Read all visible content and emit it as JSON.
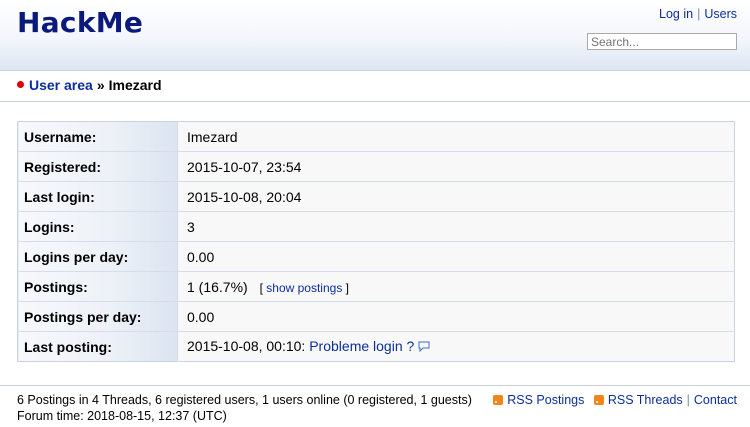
{
  "header": {
    "logo": "HackMe",
    "login_label": "Log in",
    "separator": "|",
    "users_label": "Users",
    "search_placeholder": "Search..."
  },
  "breadcrumb": {
    "parent": "User area",
    "arrow": "»",
    "current": "Imezard"
  },
  "profile": {
    "rows": [
      {
        "label": "Username:",
        "value": "Imezard"
      },
      {
        "label": "Registered:",
        "value": "2015-10-07, 23:54"
      },
      {
        "label": "Last login:",
        "value": "2015-10-08, 20:04"
      },
      {
        "label": "Logins:",
        "value": "3"
      },
      {
        "label": "Logins per day:",
        "value": "0.00"
      },
      {
        "label": "Postings:",
        "value": "1 (16.7%)"
      },
      {
        "label": "Postings per day:",
        "value": "0.00"
      },
      {
        "label": "Last posting:",
        "value": "2015-10-08, 00:10:"
      }
    ],
    "show_postings_open": "[",
    "show_postings_label": "show postings",
    "show_postings_close": "]",
    "last_posting_title": "Probleme login ?"
  },
  "footer": {
    "stats": "6 Postings in 4 Threads, 6 registered users, 1 users online (0 registered, 1 guests)",
    "forum_time": "Forum time: 2018-08-15, 12:37 (UTC)",
    "rss_postings": "RSS Postings",
    "rss_threads": "RSS Threads",
    "contact": "Contact",
    "separator": "|"
  },
  "icons": {
    "bullet": "red-dot-icon",
    "rss": "rss-icon",
    "comment": "speech-bubble-icon"
  },
  "colors": {
    "logo": "#0b1a7a",
    "link": "#0b2e9e",
    "bullet": "#e30000",
    "rss": "#f0861c"
  }
}
